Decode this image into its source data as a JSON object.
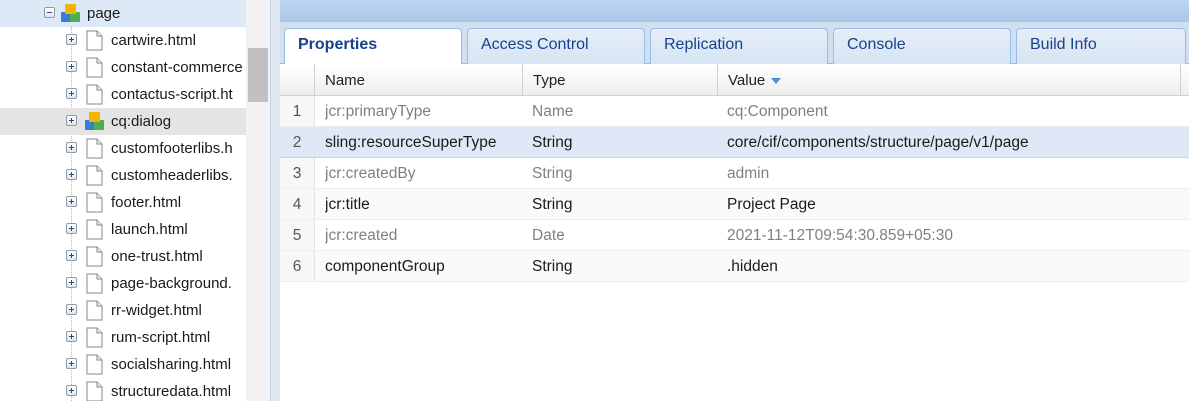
{
  "tree": {
    "root": {
      "label": "page",
      "icon": "component-icon"
    },
    "children": [
      {
        "label": "cartwire.html",
        "icon": "file-icon"
      },
      {
        "label": "constant-commerce",
        "icon": "file-icon"
      },
      {
        "label": "contactus-script.ht",
        "icon": "file-icon"
      },
      {
        "label": "cq:dialog",
        "icon": "component-icon"
      },
      {
        "label": "customfooterlibs.h",
        "icon": "file-icon"
      },
      {
        "label": "customheaderlibs.",
        "icon": "file-icon"
      },
      {
        "label": "footer.html",
        "icon": "file-icon"
      },
      {
        "label": "launch.html",
        "icon": "file-icon"
      },
      {
        "label": "one-trust.html",
        "icon": "file-icon"
      },
      {
        "label": "page-background.",
        "icon": "file-icon"
      },
      {
        "label": "rr-widget.html",
        "icon": "file-icon"
      },
      {
        "label": "rum-script.html",
        "icon": "file-icon"
      },
      {
        "label": "socialsharing.html",
        "icon": "file-icon"
      },
      {
        "label": "structuredata.html",
        "icon": "file-icon"
      }
    ]
  },
  "tabs": [
    {
      "label": "Properties",
      "active": true
    },
    {
      "label": "Access Control",
      "active": false
    },
    {
      "label": "Replication",
      "active": false
    },
    {
      "label": "Console",
      "active": false
    },
    {
      "label": "Build Info",
      "active": false
    }
  ],
  "grid": {
    "columns": {
      "name": "Name",
      "type": "Type",
      "value": "Value"
    },
    "rows": [
      {
        "num": "1",
        "name": "jcr:primaryType",
        "type": "Name",
        "value": "cq:Component",
        "muted": true
      },
      {
        "num": "2",
        "name": "sling:resourceSuperType",
        "type": "String",
        "value": "core/cif/components/structure/page/v1/page",
        "muted": false
      },
      {
        "num": "3",
        "name": "jcr:createdBy",
        "type": "String",
        "value": "admin",
        "muted": true
      },
      {
        "num": "4",
        "name": "jcr:title",
        "type": "String",
        "value": "Project Page",
        "muted": false
      },
      {
        "num": "5",
        "name": "jcr:created",
        "type": "Date",
        "value": "2021-11-12T09:54:30.859+05:30",
        "muted": true
      },
      {
        "num": "6",
        "name": "componentGroup",
        "type": "String",
        "value": ".hidden",
        "muted": false
      }
    ]
  },
  "colors": {
    "accent": "#15428b",
    "selection": "#dfe8f6",
    "tab_border": "#99bbe8"
  }
}
